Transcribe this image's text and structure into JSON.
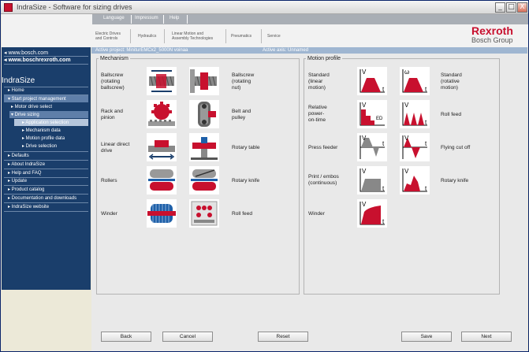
{
  "window": {
    "title": "IndraSize - Software for sizing drives",
    "controls": [
      "_",
      "□",
      "X"
    ]
  },
  "topnav": {
    "items": [
      "Language",
      "Impressum",
      "Help"
    ]
  },
  "categories": [
    {
      "line1": "Electric Drives",
      "line2": "and Controls"
    },
    {
      "line1": "Hydraulics",
      "line2": ""
    },
    {
      "line1": "Linear Motion and",
      "line2": "Assembly Technologies"
    },
    {
      "line1": "Pneumatics",
      "line2": ""
    },
    {
      "line1": "Service",
      "line2": ""
    }
  ],
  "logo": {
    "brand": "Rexroth",
    "group": "Bosch Group",
    "brand_color": "#c8102e"
  },
  "left": {
    "links": [
      "◂ www.bosch.com",
      "◂ www.boschrexroth.com"
    ],
    "app_title": "IndraSize",
    "nav": [
      {
        "label": "▸ Home"
      },
      {
        "label": "▾ Start project management"
      },
      {
        "label": "▸ Motor drive select"
      },
      {
        "label": "▾ Drive sizing"
      },
      {
        "label": "▸ Application selection"
      },
      {
        "label": "▸ Mechanism data"
      },
      {
        "label": "▸ Motion profile data"
      },
      {
        "label": "▸ Drive selection"
      },
      {
        "label": "▸ Defaults"
      },
      {
        "label": "▸ About IndraSize"
      },
      {
        "label": "▸ Help and FAQ"
      },
      {
        "label": "▸ Update"
      },
      {
        "label": "▸ Product catalog"
      },
      {
        "label": "▸ Documentation and downloads"
      },
      {
        "label": "▸ IndraSize website"
      }
    ]
  },
  "status": {
    "project": "Active project: MiniturEMCx2_5000N voinaa",
    "axis": "Active axis: Unnamed"
  },
  "mechanism": {
    "legend": "Mechanism",
    "items": [
      {
        "label": "Ballscrew\n(rotating\nballscrew)",
        "icon": "ballscrew-rotating-icon"
      },
      {
        "label": "Ballscrew\n(rotating\nnut)",
        "icon": "ballscrew-nut-icon"
      },
      {
        "label": "Rack and\npinion",
        "icon": "rack-pinion-icon"
      },
      {
        "label": "Belt and\npulley",
        "icon": "belt-pulley-icon"
      },
      {
        "label": "Linear direct\ndrive",
        "icon": "linear-drive-icon"
      },
      {
        "label": "Rotary table",
        "icon": "rotary-table-icon"
      },
      {
        "label": "Rollers",
        "icon": "rollers-icon"
      },
      {
        "label": "Rotary knife",
        "icon": "rotary-knife-icon"
      },
      {
        "label": "Winder",
        "icon": "winder-icon"
      },
      {
        "label": "Roll feed",
        "icon": "roll-feed-icon"
      }
    ]
  },
  "motion": {
    "legend": "Motion profile",
    "items": [
      {
        "label": "Standard\n(linear\nmotion)",
        "icon": "standard-linear-profile-icon"
      },
      {
        "label": "Standard\n(rotative\nmotion)",
        "icon": "standard-rotative-profile-icon"
      },
      {
        "label": "Relative\npower-\non-time",
        "icon": "relative-power-profile-icon"
      },
      {
        "label": "Roll feed",
        "icon": "roll-feed-profile-icon"
      },
      {
        "label": "Press feeder",
        "icon": "press-feeder-profile-icon"
      },
      {
        "label": "Flying cut off",
        "icon": "flying-cutoff-profile-icon"
      },
      {
        "label": "Print / embos\n(continuous)",
        "icon": "print-embos-profile-icon"
      },
      {
        "label": "Rotary knife",
        "icon": "rotary-knife-profile-icon"
      },
      {
        "label": "Winder",
        "icon": "winder-profile-icon"
      }
    ]
  },
  "buttons": {
    "back": "Back",
    "cancel": "Cancel",
    "reset": "Reset",
    "save": "Save",
    "next": "Next"
  },
  "chart_axes": {
    "v": "V",
    "omega": "ω",
    "t": "t",
    "ed": "ED"
  }
}
